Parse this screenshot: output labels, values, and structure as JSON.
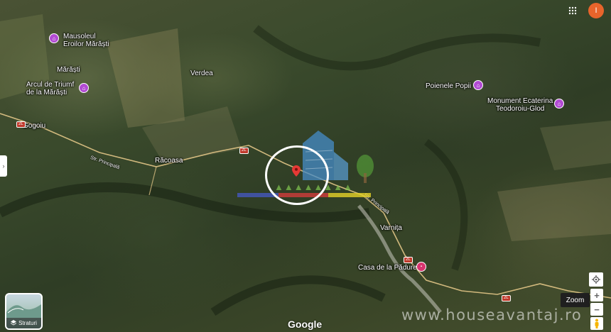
{
  "places": {
    "mausoleum": "Mausoleul\nEroilor Mărăști",
    "marasti": "Mărăști",
    "arc": "Arcul de Triumf\nde la Mărăști",
    "verdea": "Verdea",
    "gogoiu": "Gogoiu",
    "racoasa": "Răcoasa",
    "poienele": "Poienele Popii",
    "monument": "Monument Ecaterina\nTeodoroiu-Glod",
    "varnita": "Varnița",
    "casa": "Casa de la Pădure"
  },
  "roads": {
    "str_principala_left": "Str. Principală",
    "str_principala_right": "Str. Principală",
    "shield_2l_a": "2L",
    "shield_2l_b": "2L",
    "shield_2l_c": "2L",
    "shield_2l_d": "2L"
  },
  "controls": {
    "zoom_label": "Zoom",
    "layers_label": "Straturi",
    "google_logo": "Google",
    "avatar_letter": "I",
    "zoom_in": "+",
    "zoom_out": "−"
  },
  "watermark": "www.houseavantaj.ro",
  "colors": {
    "avatar": "#e8642b",
    "poi_purple": "#b24ad3",
    "poi_pink": "#d8346e",
    "road_shield": "#c0392b",
    "pin": "#e53935"
  },
  "icons": {
    "apps": "apps-grid-icon",
    "compass": "my-location-icon",
    "pegman": "street-view-pegman-icon",
    "layers": "layers-icon",
    "poi": "landmark-icon",
    "pin": "map-pin-icon"
  }
}
